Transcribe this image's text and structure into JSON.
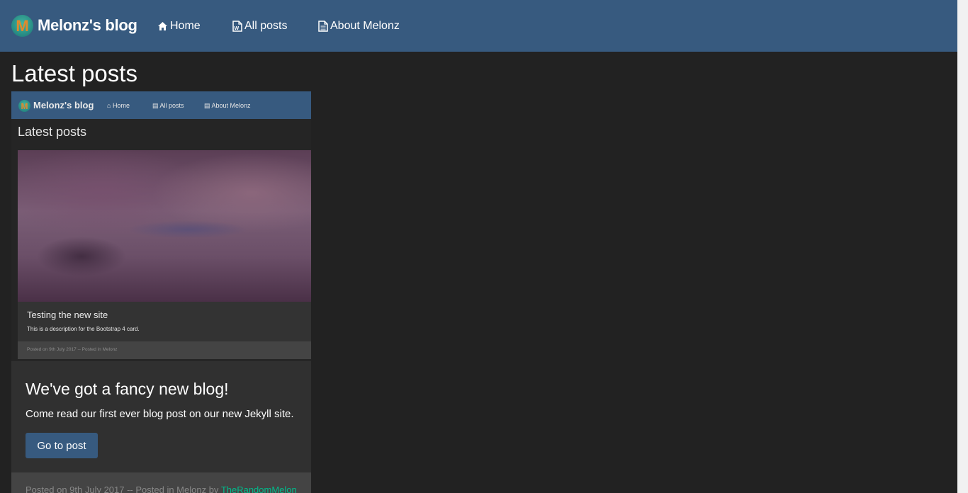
{
  "navbar": {
    "brand": "Melonz's blog",
    "logo_letter": "M",
    "links": [
      {
        "label": "Home",
        "icon": "home-icon"
      },
      {
        "label": "All posts",
        "icon": "word-file-icon"
      },
      {
        "label": "About Melonz",
        "icon": "document-icon"
      }
    ]
  },
  "page": {
    "title": "Latest posts"
  },
  "post": {
    "preview": {
      "brand": "Melonz's blog",
      "logo_letter": "M",
      "links": [
        "Home",
        "All posts",
        "About Melonz"
      ],
      "title": "Latest posts",
      "card_title": "Testing the new site",
      "card_text": "This is a description for the Bootstrap 4 card.",
      "footer": "Posted on 9th July 2017 -- Posted in Melonz"
    },
    "title": "We've got a fancy new blog!",
    "text": "Come read our first ever blog post on our new Jekyll site.",
    "button_label": "Go to post",
    "footer_prefix": "Posted on 9th July 2017 -- Posted in Melonz by ",
    "author": "TheRandomMelon"
  },
  "colors": {
    "navbar": "#375a7f",
    "background": "#222222",
    "card": "#303030",
    "link": "#00bc8c"
  }
}
